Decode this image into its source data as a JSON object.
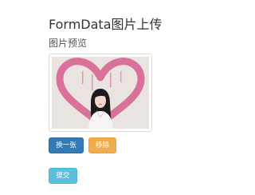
{
  "header": {
    "title": "FormData图片上传",
    "subtitle": "图片预览"
  },
  "preview": {
    "image_description": "photo: girl in front of a pink painted heart on a light wall",
    "heart_color": "#d9719a",
    "wall_color": "#e6e0dc"
  },
  "actions": {
    "change_label": "换一张",
    "remove_label": "移除",
    "submit_label": "提交"
  },
  "colors": {
    "primary": "#337ab7",
    "warning": "#f0ad4e",
    "info": "#5bc0de"
  }
}
